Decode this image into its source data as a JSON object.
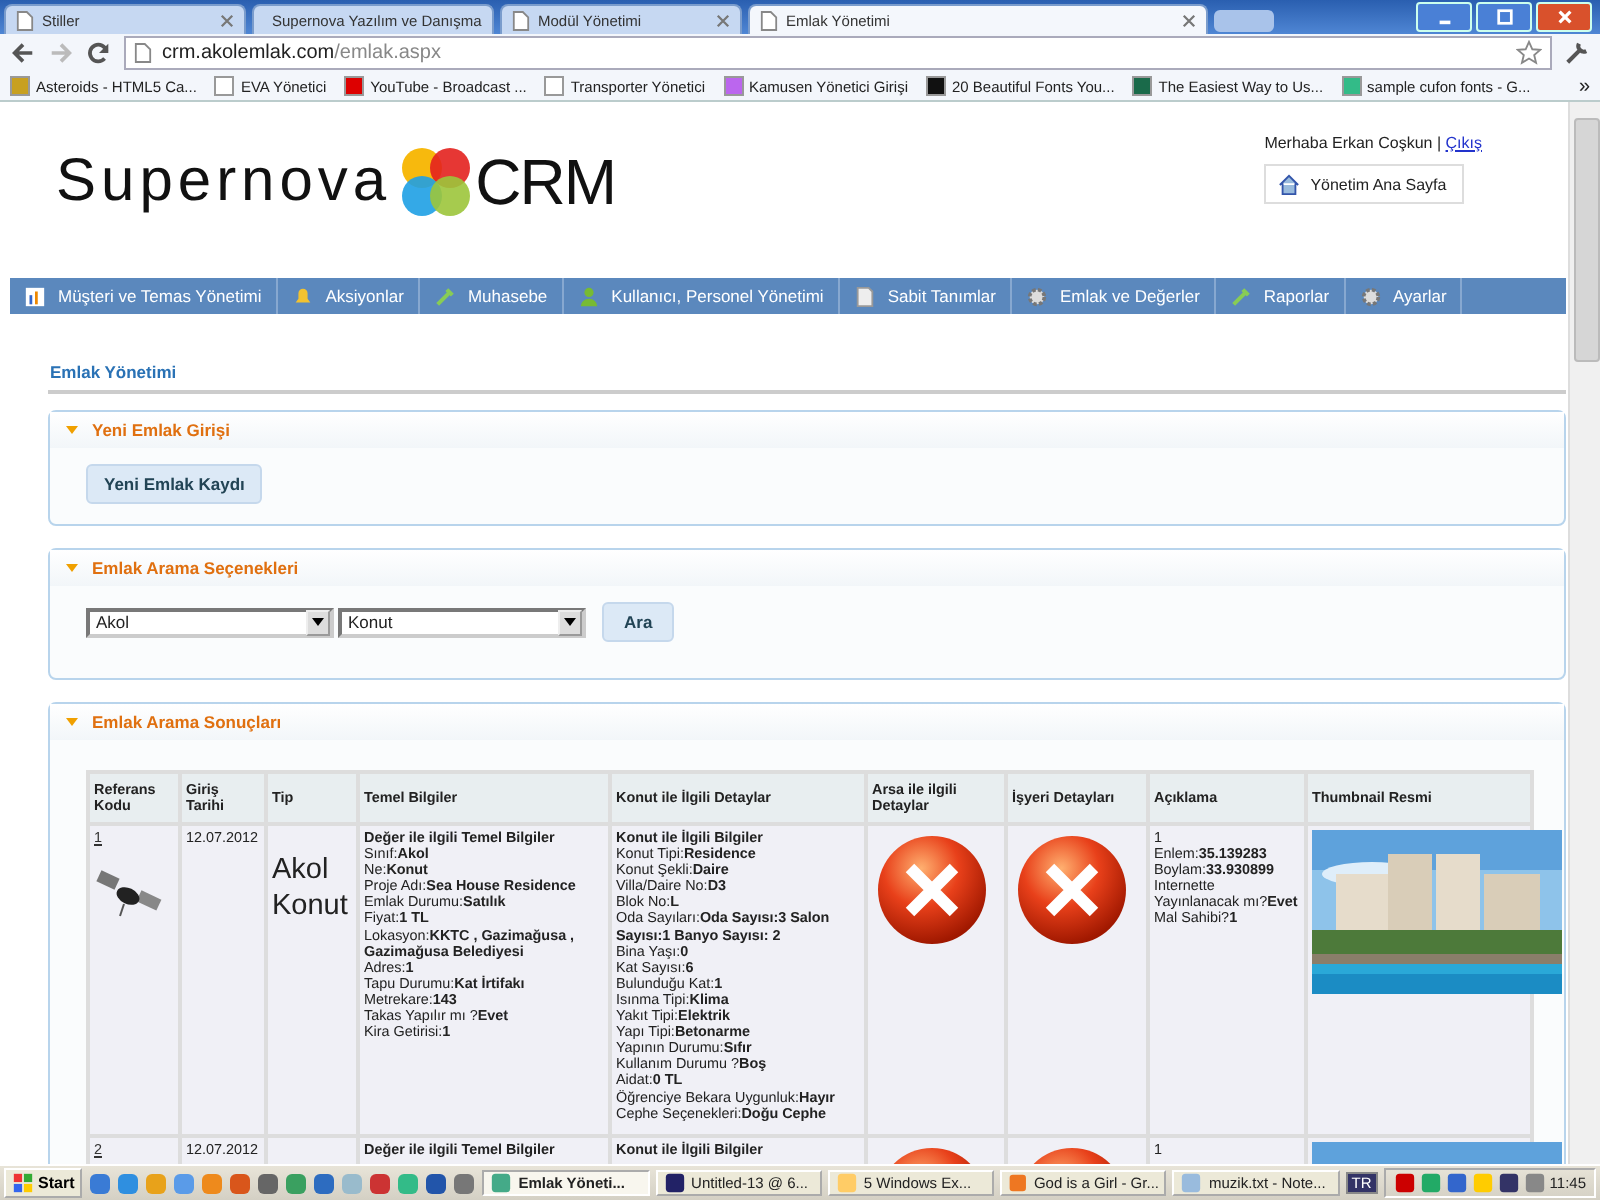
{
  "browser": {
    "tabs": [
      {
        "label": "Stiller",
        "selected": false
      },
      {
        "label": "Supernova Yazılım ve Danışma",
        "selected": false
      },
      {
        "label": "Modül Yönetimi",
        "selected": false
      },
      {
        "label": "Emlak Yönetimi",
        "selected": true
      }
    ],
    "address": {
      "host": "crm.akolemlak.com",
      "path": "/emlak.aspx"
    },
    "bookmarks": [
      {
        "label": "Asteroids - HTML5 Ca..."
      },
      {
        "label": "EVA Yönetici"
      },
      {
        "label": "YouTube - Broadcast ..."
      },
      {
        "label": "Transporter Yönetici"
      },
      {
        "label": "Kamusen Yönetici Girişi"
      },
      {
        "label": "20 Beautiful Fonts You..."
      },
      {
        "label": "The Easiest Way to Us..."
      },
      {
        "label": "sample cufon fonts - G..."
      }
    ],
    "more": "»"
  },
  "header": {
    "logo_left": "Supernova",
    "logo_right": "CRM",
    "greeting": "Merhaba Erkan Coşkun |",
    "logout": "Çıkış",
    "home_button": "Yönetim Ana Sayfa"
  },
  "menu": [
    {
      "label": "Müşteri ve Temas Yönetimi"
    },
    {
      "label": "Aksiyonlar"
    },
    {
      "label": "Muhasebe"
    },
    {
      "label": "Kullanıcı, Personel Yönetimi"
    },
    {
      "label": "Sabit Tanımlar"
    },
    {
      "label": "Emlak ve Değerler"
    },
    {
      "label": "Raporlar"
    },
    {
      "label": "Ayarlar"
    }
  ],
  "page_title": "Emlak Yönetimi",
  "new_entry": {
    "title": "Yeni Emlak Girişi",
    "button": "Yeni Emlak Kaydı"
  },
  "search": {
    "title": "Emlak Arama Seçenekleri",
    "selects": [
      "Akol",
      "Konut"
    ],
    "button": "Ara"
  },
  "results": {
    "title": "Emlak Arama Sonuçları",
    "columns": [
      "Referans Kodu",
      "Giriş Tarihi",
      "Tip",
      "Temel Bilgiler",
      "Konut ile İlgili Detaylar",
      "Arsa ile ilgili Detaylar",
      "İşyeri Detayları",
      "Açıklama",
      "Thumbnail Resmi"
    ],
    "rows": [
      {
        "ref": "1",
        "date": "12.07.2012",
        "type": "Akol Konut",
        "basic": {
          "heading": "Değer ile ilgili Temel Bilgiler",
          "lines": [
            "Sınıf:**Akol**",
            "Ne:**Konut**",
            "Proje Adı:**Sea House Residence**",
            "Emlak Durumu:**Satılık**",
            "Fiyat:**1 TL**",
            "Lokasyon:**KKTC , Gazimağusa , Gazimağusa Belediyesi**",
            "Adres:**1**",
            "Tapu Durumu:**Kat İrtifakı**",
            "Metrekare:**143**",
            "Takas Yapılır mı ?**Evet**",
            "Kira Getirisi:**1**"
          ]
        },
        "housing": {
          "heading": "Konut ile İlgili Bilgiler",
          "lines": [
            "Konut Tipi:**Residence**",
            "Konut Şekli:**Daire**",
            "Villa/Daire No:**D3**",
            "Blok No:**L**",
            "Oda Sayıları:**Oda Sayısı:3 Salon Sayısı:1 Banyo Sayısı: 2**",
            "Bina Yaşı:**0**",
            "Kat Sayısı:**6**",
            "Bulunduğu Kat:**1**",
            "Isınma Tipi:**Klima**",
            "Yakıt Tipi:**Elektrik**",
            "Yapı Tipi:**Betonarme**",
            "Yapının Durumu:**Sıfır**",
            "Kullanım Durumu ?**Boş**",
            "Aidat:**0 TL**",
            "Öğrenciye Bekara Uygunluk:**Hayır**",
            "Cephe Seçenekleri:**Doğu Cephe**"
          ]
        },
        "note": {
          "first": "1",
          "lines": [
            "Enlem:**35.139283**",
            "Boylam:**33.930899**",
            "Internette Yayınlanacak mı?**Evet**",
            "Mal Sahibi?**1**"
          ]
        }
      },
      {
        "ref": "2",
        "date": "12.07.2012",
        "basic": {
          "heading": "Değer ile ilgili Temel Bilgiler"
        },
        "housing": {
          "heading": "Konut ile İlgili Bilgiler"
        },
        "note": {
          "first": "1"
        }
      }
    ]
  },
  "taskbar": {
    "start": "Start",
    "tasks": [
      {
        "label": "Emlak Yöneti...",
        "selected": true
      },
      {
        "label": "Untitled-13 @ 6...",
        "selected": false
      },
      {
        "label": "5 Windows Ex...",
        "selected": false
      },
      {
        "label": "God is a Girl - Gr...",
        "selected": false
      },
      {
        "label": "muzik.txt - Note...",
        "selected": false
      }
    ],
    "language": "TR",
    "time": "11:45"
  }
}
